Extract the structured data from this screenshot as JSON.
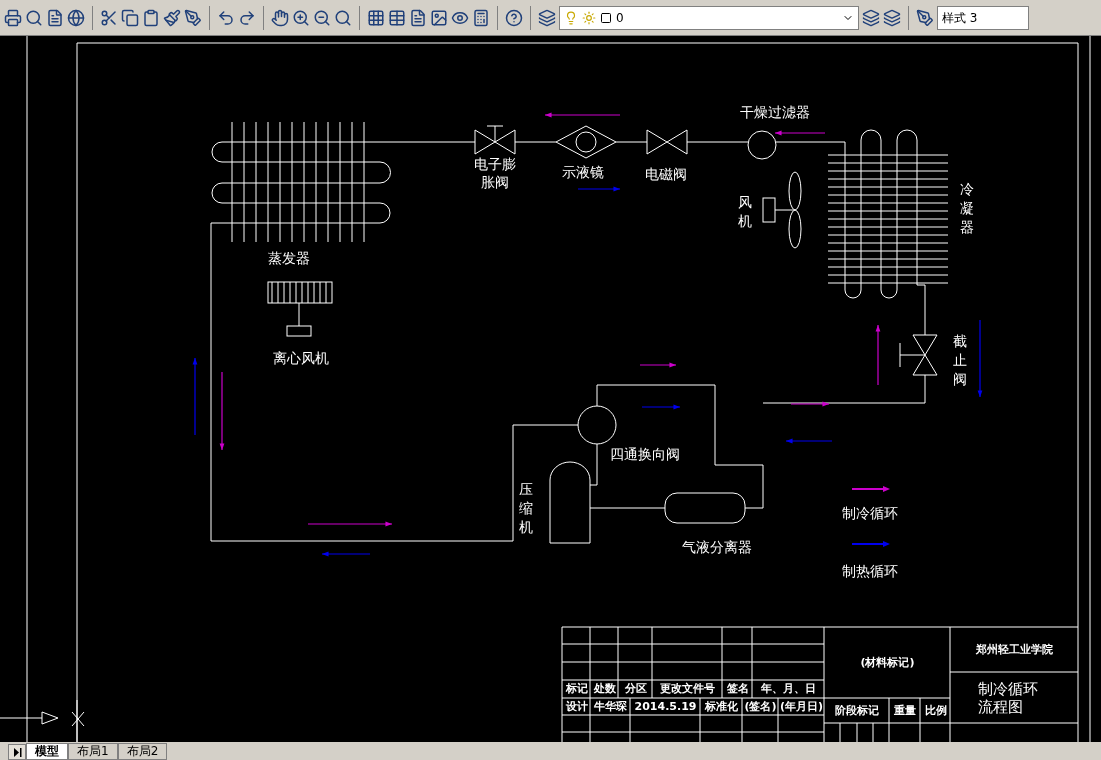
{
  "toolbar": {
    "layer_value": "0",
    "text_style": "样式 3"
  },
  "labels": [
    {
      "text": "干燥过滤器",
      "kind": "horizontal"
    },
    {
      "text": "电子膨胀阀",
      "kind": "wrapped"
    },
    {
      "text": "示液镜",
      "kind": "horizontal"
    },
    {
      "text": "电磁阀",
      "kind": "horizontal"
    },
    {
      "text": "风机",
      "kind": "vertical"
    },
    {
      "text": "冷凝器",
      "kind": "vertical"
    },
    {
      "text": "蒸发器",
      "kind": "horizontal"
    },
    {
      "text": "离心风机",
      "kind": "horizontal"
    },
    {
      "text": "截止阀",
      "kind": "vertical"
    },
    {
      "text": "四通换向阀",
      "kind": "horizontal"
    },
    {
      "text": "压缩机",
      "kind": "vertical"
    },
    {
      "text": "气液分离器",
      "kind": "horizontal"
    }
  ],
  "legend": [
    {
      "label": "制冷循环",
      "color": "#cc00cc"
    },
    {
      "label": "制热循环",
      "color": "#0000ee"
    }
  ],
  "title_block": {
    "cells": [
      "标记",
      "处数",
      "分区",
      "更改文件号",
      "签名",
      "年、月、日",
      "设计",
      "牛华琛",
      "2014.5.19",
      "标准化",
      "(签名)",
      "(年月日)",
      "(材料标记)",
      "阶段标记",
      "重量",
      "比例",
      "郑州轻工业学院"
    ],
    "drawing_title": [
      "制冷循环",
      "流程图"
    ]
  },
  "tabs": [
    {
      "label": "模型",
      "selected": true
    },
    {
      "label": "布局1",
      "selected": false
    },
    {
      "label": "布局2",
      "selected": false
    }
  ]
}
